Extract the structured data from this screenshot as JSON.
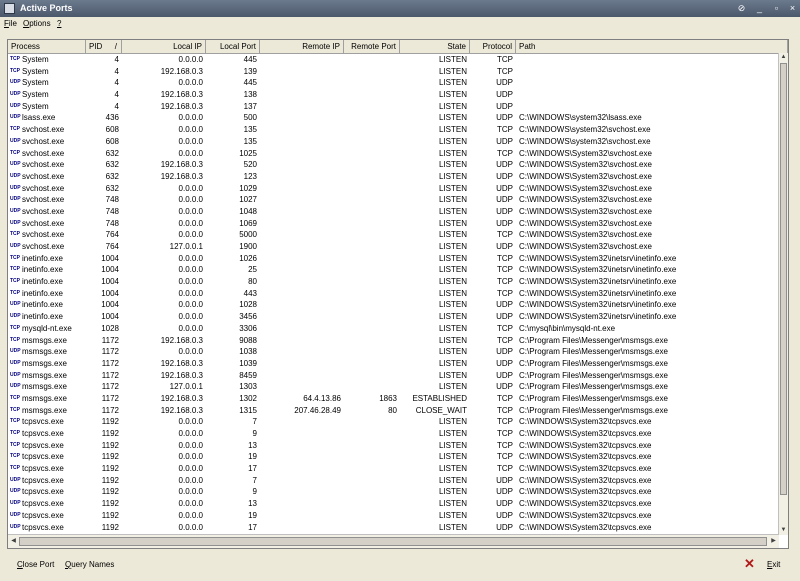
{
  "window": {
    "title": "Active Ports",
    "minimize": "_",
    "maximize": "▫",
    "close": "×"
  },
  "menu": [
    {
      "key": "F",
      "rest": "ile"
    },
    {
      "key": "O",
      "rest": "ptions"
    },
    {
      "key": "?",
      "rest": ""
    }
  ],
  "columns": {
    "process": "Process",
    "pid": "PID",
    "sort_indicator": "/",
    "local_ip": "Local IP",
    "local_port": "Local Port",
    "remote_ip": "Remote IP",
    "remote_port": "Remote Port",
    "state": "State",
    "protocol": "Protocol",
    "path": "Path"
  },
  "rows": [
    {
      "tag": "TCP",
      "proc": "System",
      "pid": "4",
      "lip": "0.0.0.0",
      "lport": "445",
      "rip": "",
      "rport": "",
      "state": "LISTEN",
      "prot": "TCP",
      "path": ""
    },
    {
      "tag": "TCP",
      "proc": "System",
      "pid": "4",
      "lip": "192.168.0.3",
      "lport": "139",
      "rip": "",
      "rport": "",
      "state": "LISTEN",
      "prot": "TCP",
      "path": ""
    },
    {
      "tag": "UDP",
      "proc": "System",
      "pid": "4",
      "lip": "0.0.0.0",
      "lport": "445",
      "rip": "",
      "rport": "",
      "state": "LISTEN",
      "prot": "UDP",
      "path": ""
    },
    {
      "tag": "UDP",
      "proc": "System",
      "pid": "4",
      "lip": "192.168.0.3",
      "lport": "138",
      "rip": "",
      "rport": "",
      "state": "LISTEN",
      "prot": "UDP",
      "path": ""
    },
    {
      "tag": "UDP",
      "proc": "System",
      "pid": "4",
      "lip": "192.168.0.3",
      "lport": "137",
      "rip": "",
      "rport": "",
      "state": "LISTEN",
      "prot": "UDP",
      "path": ""
    },
    {
      "tag": "UDP",
      "proc": "lsass.exe",
      "pid": "436",
      "lip": "0.0.0.0",
      "lport": "500",
      "rip": "",
      "rport": "",
      "state": "LISTEN",
      "prot": "UDP",
      "path": "C:\\WINDOWS\\system32\\lsass.exe"
    },
    {
      "tag": "TCP",
      "proc": "svchost.exe",
      "pid": "608",
      "lip": "0.0.0.0",
      "lport": "135",
      "rip": "",
      "rport": "",
      "state": "LISTEN",
      "prot": "TCP",
      "path": "C:\\WINDOWS\\system32\\svchost.exe"
    },
    {
      "tag": "UDP",
      "proc": "svchost.exe",
      "pid": "608",
      "lip": "0.0.0.0",
      "lport": "135",
      "rip": "",
      "rport": "",
      "state": "LISTEN",
      "prot": "UDP",
      "path": "C:\\WINDOWS\\system32\\svchost.exe"
    },
    {
      "tag": "TCP",
      "proc": "svchost.exe",
      "pid": "632",
      "lip": "0.0.0.0",
      "lport": "1025",
      "rip": "",
      "rport": "",
      "state": "LISTEN",
      "prot": "TCP",
      "path": "C:\\WINDOWS\\System32\\svchost.exe"
    },
    {
      "tag": "UDP",
      "proc": "svchost.exe",
      "pid": "632",
      "lip": "192.168.0.3",
      "lport": "520",
      "rip": "",
      "rport": "",
      "state": "LISTEN",
      "prot": "UDP",
      "path": "C:\\WINDOWS\\System32\\svchost.exe"
    },
    {
      "tag": "UDP",
      "proc": "svchost.exe",
      "pid": "632",
      "lip": "192.168.0.3",
      "lport": "123",
      "rip": "",
      "rport": "",
      "state": "LISTEN",
      "prot": "UDP",
      "path": "C:\\WINDOWS\\System32\\svchost.exe"
    },
    {
      "tag": "UDP",
      "proc": "svchost.exe",
      "pid": "632",
      "lip": "0.0.0.0",
      "lport": "1029",
      "rip": "",
      "rport": "",
      "state": "LISTEN",
      "prot": "UDP",
      "path": "C:\\WINDOWS\\System32\\svchost.exe"
    },
    {
      "tag": "UDP",
      "proc": "svchost.exe",
      "pid": "748",
      "lip": "0.0.0.0",
      "lport": "1027",
      "rip": "",
      "rport": "",
      "state": "LISTEN",
      "prot": "UDP",
      "path": "C:\\WINDOWS\\System32\\svchost.exe"
    },
    {
      "tag": "UDP",
      "proc": "svchost.exe",
      "pid": "748",
      "lip": "0.0.0.0",
      "lport": "1048",
      "rip": "",
      "rport": "",
      "state": "LISTEN",
      "prot": "UDP",
      "path": "C:\\WINDOWS\\System32\\svchost.exe"
    },
    {
      "tag": "UDP",
      "proc": "svchost.exe",
      "pid": "748",
      "lip": "0.0.0.0",
      "lport": "1069",
      "rip": "",
      "rport": "",
      "state": "LISTEN",
      "prot": "UDP",
      "path": "C:\\WINDOWS\\System32\\svchost.exe"
    },
    {
      "tag": "TCP",
      "proc": "svchost.exe",
      "pid": "764",
      "lip": "0.0.0.0",
      "lport": "5000",
      "rip": "",
      "rport": "",
      "state": "LISTEN",
      "prot": "TCP",
      "path": "C:\\WINDOWS\\System32\\svchost.exe"
    },
    {
      "tag": "UDP",
      "proc": "svchost.exe",
      "pid": "764",
      "lip": "127.0.0.1",
      "lport": "1900",
      "rip": "",
      "rport": "",
      "state": "LISTEN",
      "prot": "UDP",
      "path": "C:\\WINDOWS\\System32\\svchost.exe"
    },
    {
      "tag": "TCP",
      "proc": "inetinfo.exe",
      "pid": "1004",
      "lip": "0.0.0.0",
      "lport": "1026",
      "rip": "",
      "rport": "",
      "state": "LISTEN",
      "prot": "TCP",
      "path": "C:\\WINDOWS\\System32\\inetsrv\\inetinfo.exe"
    },
    {
      "tag": "TCP",
      "proc": "inetinfo.exe",
      "pid": "1004",
      "lip": "0.0.0.0",
      "lport": "25",
      "rip": "",
      "rport": "",
      "state": "LISTEN",
      "prot": "TCP",
      "path": "C:\\WINDOWS\\System32\\inetsrv\\inetinfo.exe"
    },
    {
      "tag": "TCP",
      "proc": "inetinfo.exe",
      "pid": "1004",
      "lip": "0.0.0.0",
      "lport": "80",
      "rip": "",
      "rport": "",
      "state": "LISTEN",
      "prot": "TCP",
      "path": "C:\\WINDOWS\\System32\\inetsrv\\inetinfo.exe"
    },
    {
      "tag": "TCP",
      "proc": "inetinfo.exe",
      "pid": "1004",
      "lip": "0.0.0.0",
      "lport": "443",
      "rip": "",
      "rport": "",
      "state": "LISTEN",
      "prot": "TCP",
      "path": "C:\\WINDOWS\\System32\\inetsrv\\inetinfo.exe"
    },
    {
      "tag": "UDP",
      "proc": "inetinfo.exe",
      "pid": "1004",
      "lip": "0.0.0.0",
      "lport": "1028",
      "rip": "",
      "rport": "",
      "state": "LISTEN",
      "prot": "UDP",
      "path": "C:\\WINDOWS\\System32\\inetsrv\\inetinfo.exe"
    },
    {
      "tag": "UDP",
      "proc": "inetinfo.exe",
      "pid": "1004",
      "lip": "0.0.0.0",
      "lport": "3456",
      "rip": "",
      "rport": "",
      "state": "LISTEN",
      "prot": "UDP",
      "path": "C:\\WINDOWS\\System32\\inetsrv\\inetinfo.exe"
    },
    {
      "tag": "TCP",
      "proc": "mysqld-nt.exe",
      "pid": "1028",
      "lip": "0.0.0.0",
      "lport": "3306",
      "rip": "",
      "rport": "",
      "state": "LISTEN",
      "prot": "TCP",
      "path": "C:\\mysql\\bin\\mysqld-nt.exe"
    },
    {
      "tag": "TCP",
      "proc": "msmsgs.exe",
      "pid": "1172",
      "lip": "192.168.0.3",
      "lport": "9088",
      "rip": "",
      "rport": "",
      "state": "LISTEN",
      "prot": "TCP",
      "path": "C:\\Program Files\\Messenger\\msmsgs.exe"
    },
    {
      "tag": "UDP",
      "proc": "msmsgs.exe",
      "pid": "1172",
      "lip": "0.0.0.0",
      "lport": "1038",
      "rip": "",
      "rport": "",
      "state": "LISTEN",
      "prot": "UDP",
      "path": "C:\\Program Files\\Messenger\\msmsgs.exe"
    },
    {
      "tag": "UDP",
      "proc": "msmsgs.exe",
      "pid": "1172",
      "lip": "192.168.0.3",
      "lport": "1039",
      "rip": "",
      "rport": "",
      "state": "LISTEN",
      "prot": "UDP",
      "path": "C:\\Program Files\\Messenger\\msmsgs.exe"
    },
    {
      "tag": "UDP",
      "proc": "msmsgs.exe",
      "pid": "1172",
      "lip": "192.168.0.3",
      "lport": "8459",
      "rip": "",
      "rport": "",
      "state": "LISTEN",
      "prot": "UDP",
      "path": "C:\\Program Files\\Messenger\\msmsgs.exe"
    },
    {
      "tag": "UDP",
      "proc": "msmsgs.exe",
      "pid": "1172",
      "lip": "127.0.0.1",
      "lport": "1303",
      "rip": "",
      "rport": "",
      "state": "LISTEN",
      "prot": "UDP",
      "path": "C:\\Program Files\\Messenger\\msmsgs.exe"
    },
    {
      "tag": "TCP",
      "proc": "msmsgs.exe",
      "pid": "1172",
      "lip": "192.168.0.3",
      "lport": "1302",
      "rip": "64.4.13.86",
      "rport": "1863",
      "state": "ESTABLISHED",
      "prot": "TCP",
      "path": "C:\\Program Files\\Messenger\\msmsgs.exe"
    },
    {
      "tag": "TCP",
      "proc": "msmsgs.exe",
      "pid": "1172",
      "lip": "192.168.0.3",
      "lport": "1315",
      "rip": "207.46.28.49",
      "rport": "80",
      "state": "CLOSE_WAIT",
      "prot": "TCP",
      "path": "C:\\Program Files\\Messenger\\msmsgs.exe"
    },
    {
      "tag": "TCP",
      "proc": "tcpsvcs.exe",
      "pid": "1192",
      "lip": "0.0.0.0",
      "lport": "7",
      "rip": "",
      "rport": "",
      "state": "LISTEN",
      "prot": "TCP",
      "path": "C:\\WINDOWS\\System32\\tcpsvcs.exe"
    },
    {
      "tag": "TCP",
      "proc": "tcpsvcs.exe",
      "pid": "1192",
      "lip": "0.0.0.0",
      "lport": "9",
      "rip": "",
      "rport": "",
      "state": "LISTEN",
      "prot": "TCP",
      "path": "C:\\WINDOWS\\System32\\tcpsvcs.exe"
    },
    {
      "tag": "TCP",
      "proc": "tcpsvcs.exe",
      "pid": "1192",
      "lip": "0.0.0.0",
      "lport": "13",
      "rip": "",
      "rport": "",
      "state": "LISTEN",
      "prot": "TCP",
      "path": "C:\\WINDOWS\\System32\\tcpsvcs.exe"
    },
    {
      "tag": "TCP",
      "proc": "tcpsvcs.exe",
      "pid": "1192",
      "lip": "0.0.0.0",
      "lport": "19",
      "rip": "",
      "rport": "",
      "state": "LISTEN",
      "prot": "TCP",
      "path": "C:\\WINDOWS\\System32\\tcpsvcs.exe"
    },
    {
      "tag": "TCP",
      "proc": "tcpsvcs.exe",
      "pid": "1192",
      "lip": "0.0.0.0",
      "lport": "17",
      "rip": "",
      "rport": "",
      "state": "LISTEN",
      "prot": "TCP",
      "path": "C:\\WINDOWS\\System32\\tcpsvcs.exe"
    },
    {
      "tag": "UDP",
      "proc": "tcpsvcs.exe",
      "pid": "1192",
      "lip": "0.0.0.0",
      "lport": "7",
      "rip": "",
      "rport": "",
      "state": "LISTEN",
      "prot": "UDP",
      "path": "C:\\WINDOWS\\System32\\tcpsvcs.exe"
    },
    {
      "tag": "UDP",
      "proc": "tcpsvcs.exe",
      "pid": "1192",
      "lip": "0.0.0.0",
      "lport": "9",
      "rip": "",
      "rport": "",
      "state": "LISTEN",
      "prot": "UDP",
      "path": "C:\\WINDOWS\\System32\\tcpsvcs.exe"
    },
    {
      "tag": "UDP",
      "proc": "tcpsvcs.exe",
      "pid": "1192",
      "lip": "0.0.0.0",
      "lport": "13",
      "rip": "",
      "rport": "",
      "state": "LISTEN",
      "prot": "UDP",
      "path": "C:\\WINDOWS\\System32\\tcpsvcs.exe"
    },
    {
      "tag": "UDP",
      "proc": "tcpsvcs.exe",
      "pid": "1192",
      "lip": "0.0.0.0",
      "lport": "19",
      "rip": "",
      "rport": "",
      "state": "LISTEN",
      "prot": "UDP",
      "path": "C:\\WINDOWS\\System32\\tcpsvcs.exe"
    },
    {
      "tag": "UDP",
      "proc": "tcpsvcs.exe",
      "pid": "1192",
      "lip": "0.0.0.0",
      "lport": "17",
      "rip": "",
      "rport": "",
      "state": "LISTEN",
      "prot": "UDP",
      "path": "C:\\WINDOWS\\System32\\tcpsvcs.exe"
    }
  ],
  "footer": {
    "close_port": {
      "key": "C",
      "rest": "lose Port"
    },
    "query_names": {
      "key": "Q",
      "rest": "uery Names"
    },
    "exit": {
      "key": "E",
      "rest": "xit"
    },
    "exit_icon": "x-icon"
  }
}
